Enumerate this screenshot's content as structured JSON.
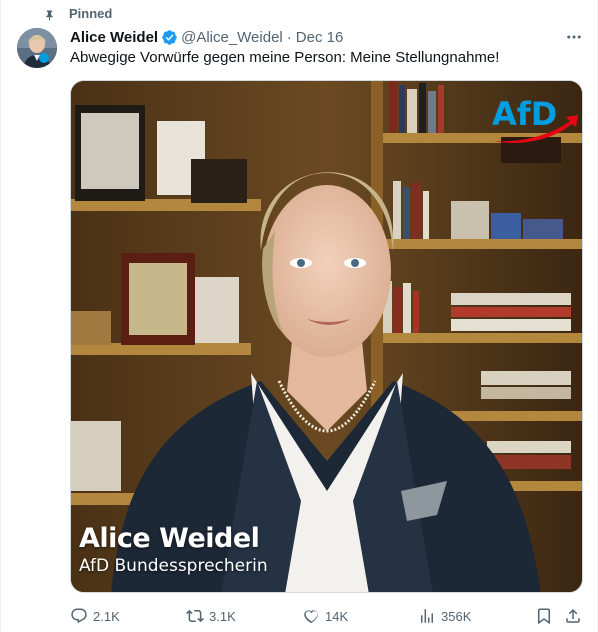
{
  "pinned": {
    "label": "Pinned",
    "icon": "pin-icon"
  },
  "author": {
    "name": "Alice Weidel",
    "handle": "@Alice_Weidel",
    "separator": "·",
    "date": "Dec 16",
    "verified": true,
    "avatar": "avatar-photo"
  },
  "tweet": {
    "text": "Abwegige Vorwürfe gegen meine Person: Meine Stellungnahme!"
  },
  "media": {
    "type": "video-thumbnail",
    "logo_text": "AfD",
    "logo_color": "#009ee0",
    "logo_arrow_color": "#e30613",
    "lower_third_name": "Alice Weidel",
    "lower_third_role": "AfD Bundessprecherin"
  },
  "actions": {
    "replies": "2.1K",
    "reposts": "3.1K",
    "likes": "14K",
    "views": "356K"
  },
  "colors": {
    "text": "#0f1419",
    "muted": "#536471",
    "verified": "#1d9bf0",
    "border": "#cfd9de"
  }
}
